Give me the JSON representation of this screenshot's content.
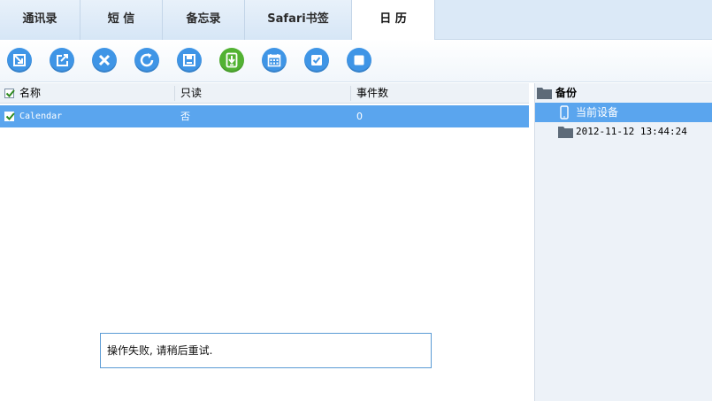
{
  "tabs": [
    {
      "label": "通讯录",
      "active": false
    },
    {
      "label": "短  信",
      "active": false
    },
    {
      "label": "备忘录",
      "active": false
    },
    {
      "label": "Safari书签",
      "active": false
    },
    {
      "label": "日  历",
      "active": true
    }
  ],
  "toolbar": {
    "buttons": [
      {
        "name": "import-icon",
        "color": "#3f95e6"
      },
      {
        "name": "export-icon",
        "color": "#3f95e6"
      },
      {
        "name": "delete-icon",
        "color": "#3f95e6"
      },
      {
        "name": "refresh-icon",
        "color": "#3f95e6"
      },
      {
        "name": "save-icon",
        "color": "#3f95e6"
      },
      {
        "name": "install-to-device-icon",
        "color": "#52b233"
      },
      {
        "name": "calendar-icon",
        "color": "#3f95e6"
      },
      {
        "name": "select-all-icon",
        "color": "#3f95e6"
      },
      {
        "name": "stop-icon",
        "color": "#3f95e6"
      }
    ]
  },
  "table": {
    "headers": [
      "名称",
      "只读",
      "事件数"
    ],
    "header_checked": true,
    "rows": [
      {
        "checked": true,
        "name": "Calendar",
        "readonly": "否",
        "events": "0"
      }
    ]
  },
  "sidepanel": {
    "title": "备份",
    "items": [
      {
        "label": "当前设备",
        "icon": "phone-icon",
        "selected": true
      },
      {
        "label": "2012-11-12 13:44:24",
        "icon": "folder-icon",
        "selected": false
      }
    ]
  },
  "message": {
    "text": "操作失败, 请稍后重试."
  },
  "colors": {
    "accent": "#3f95e6",
    "selection": "#5aa5ee",
    "green": "#52b233",
    "tabbar": "#dbe9f7"
  }
}
